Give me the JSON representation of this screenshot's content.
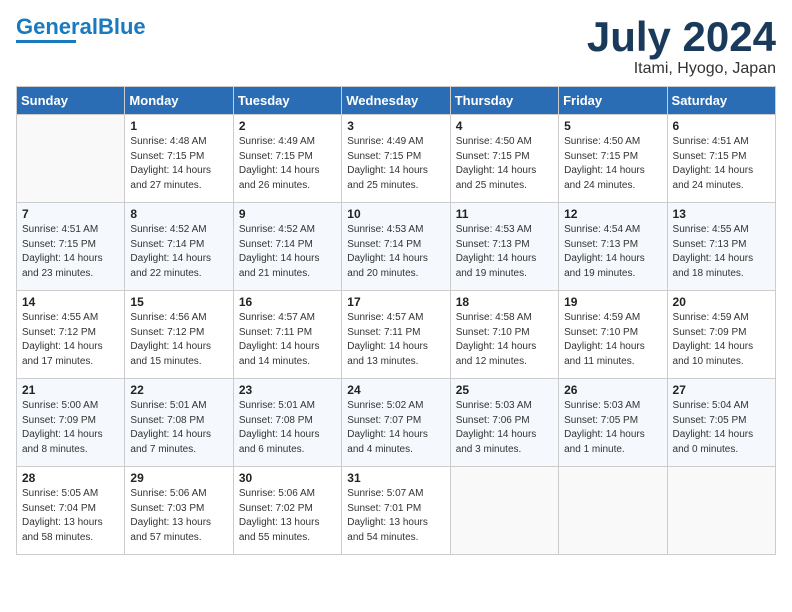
{
  "header": {
    "logo_line1": "General",
    "logo_line2": "Blue",
    "month_year": "July 2024",
    "location": "Itami, Hyogo, Japan"
  },
  "days_of_week": [
    "Sunday",
    "Monday",
    "Tuesday",
    "Wednesday",
    "Thursday",
    "Friday",
    "Saturday"
  ],
  "weeks": [
    [
      {
        "day": "",
        "info": ""
      },
      {
        "day": "1",
        "info": "Sunrise: 4:48 AM\nSunset: 7:15 PM\nDaylight: 14 hours\nand 27 minutes."
      },
      {
        "day": "2",
        "info": "Sunrise: 4:49 AM\nSunset: 7:15 PM\nDaylight: 14 hours\nand 26 minutes."
      },
      {
        "day": "3",
        "info": "Sunrise: 4:49 AM\nSunset: 7:15 PM\nDaylight: 14 hours\nand 25 minutes."
      },
      {
        "day": "4",
        "info": "Sunrise: 4:50 AM\nSunset: 7:15 PM\nDaylight: 14 hours\nand 25 minutes."
      },
      {
        "day": "5",
        "info": "Sunrise: 4:50 AM\nSunset: 7:15 PM\nDaylight: 14 hours\nand 24 minutes."
      },
      {
        "day": "6",
        "info": "Sunrise: 4:51 AM\nSunset: 7:15 PM\nDaylight: 14 hours\nand 24 minutes."
      }
    ],
    [
      {
        "day": "7",
        "info": "Sunrise: 4:51 AM\nSunset: 7:15 PM\nDaylight: 14 hours\nand 23 minutes."
      },
      {
        "day": "8",
        "info": "Sunrise: 4:52 AM\nSunset: 7:14 PM\nDaylight: 14 hours\nand 22 minutes."
      },
      {
        "day": "9",
        "info": "Sunrise: 4:52 AM\nSunset: 7:14 PM\nDaylight: 14 hours\nand 21 minutes."
      },
      {
        "day": "10",
        "info": "Sunrise: 4:53 AM\nSunset: 7:14 PM\nDaylight: 14 hours\nand 20 minutes."
      },
      {
        "day": "11",
        "info": "Sunrise: 4:53 AM\nSunset: 7:13 PM\nDaylight: 14 hours\nand 19 minutes."
      },
      {
        "day": "12",
        "info": "Sunrise: 4:54 AM\nSunset: 7:13 PM\nDaylight: 14 hours\nand 19 minutes."
      },
      {
        "day": "13",
        "info": "Sunrise: 4:55 AM\nSunset: 7:13 PM\nDaylight: 14 hours\nand 18 minutes."
      }
    ],
    [
      {
        "day": "14",
        "info": "Sunrise: 4:55 AM\nSunset: 7:12 PM\nDaylight: 14 hours\nand 17 minutes."
      },
      {
        "day": "15",
        "info": "Sunrise: 4:56 AM\nSunset: 7:12 PM\nDaylight: 14 hours\nand 15 minutes."
      },
      {
        "day": "16",
        "info": "Sunrise: 4:57 AM\nSunset: 7:11 PM\nDaylight: 14 hours\nand 14 minutes."
      },
      {
        "day": "17",
        "info": "Sunrise: 4:57 AM\nSunset: 7:11 PM\nDaylight: 14 hours\nand 13 minutes."
      },
      {
        "day": "18",
        "info": "Sunrise: 4:58 AM\nSunset: 7:10 PM\nDaylight: 14 hours\nand 12 minutes."
      },
      {
        "day": "19",
        "info": "Sunrise: 4:59 AM\nSunset: 7:10 PM\nDaylight: 14 hours\nand 11 minutes."
      },
      {
        "day": "20",
        "info": "Sunrise: 4:59 AM\nSunset: 7:09 PM\nDaylight: 14 hours\nand 10 minutes."
      }
    ],
    [
      {
        "day": "21",
        "info": "Sunrise: 5:00 AM\nSunset: 7:09 PM\nDaylight: 14 hours\nand 8 minutes."
      },
      {
        "day": "22",
        "info": "Sunrise: 5:01 AM\nSunset: 7:08 PM\nDaylight: 14 hours\nand 7 minutes."
      },
      {
        "day": "23",
        "info": "Sunrise: 5:01 AM\nSunset: 7:08 PM\nDaylight: 14 hours\nand 6 minutes."
      },
      {
        "day": "24",
        "info": "Sunrise: 5:02 AM\nSunset: 7:07 PM\nDaylight: 14 hours\nand 4 minutes."
      },
      {
        "day": "25",
        "info": "Sunrise: 5:03 AM\nSunset: 7:06 PM\nDaylight: 14 hours\nand 3 minutes."
      },
      {
        "day": "26",
        "info": "Sunrise: 5:03 AM\nSunset: 7:05 PM\nDaylight: 14 hours\nand 1 minute."
      },
      {
        "day": "27",
        "info": "Sunrise: 5:04 AM\nSunset: 7:05 PM\nDaylight: 14 hours\nand 0 minutes."
      }
    ],
    [
      {
        "day": "28",
        "info": "Sunrise: 5:05 AM\nSunset: 7:04 PM\nDaylight: 13 hours\nand 58 minutes."
      },
      {
        "day": "29",
        "info": "Sunrise: 5:06 AM\nSunset: 7:03 PM\nDaylight: 13 hours\nand 57 minutes."
      },
      {
        "day": "30",
        "info": "Sunrise: 5:06 AM\nSunset: 7:02 PM\nDaylight: 13 hours\nand 55 minutes."
      },
      {
        "day": "31",
        "info": "Sunrise: 5:07 AM\nSunset: 7:01 PM\nDaylight: 13 hours\nand 54 minutes."
      },
      {
        "day": "",
        "info": ""
      },
      {
        "day": "",
        "info": ""
      },
      {
        "day": "",
        "info": ""
      }
    ]
  ]
}
